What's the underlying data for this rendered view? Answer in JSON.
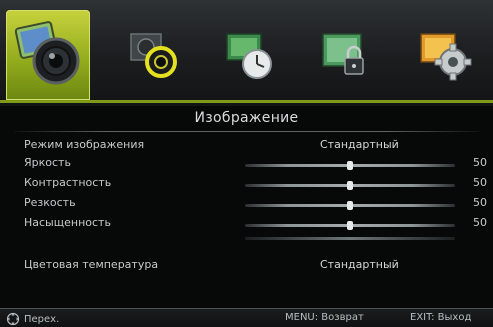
{
  "tabs": [
    {
      "name": "picture",
      "icon": "camera-lens-icon",
      "active": true
    },
    {
      "name": "sound",
      "icon": "speaker-icon",
      "active": false
    },
    {
      "name": "time",
      "icon": "clock-icon",
      "active": false
    },
    {
      "name": "lock",
      "icon": "lock-icon",
      "active": false
    },
    {
      "name": "setup",
      "icon": "gear-icon",
      "active": false
    }
  ],
  "menu": {
    "title": "Изображение",
    "picture_mode": {
      "label": "Режим изображения",
      "value": "Стандартный"
    },
    "sliders": [
      {
        "label": "Яркость",
        "value": "50",
        "level": 0.5
      },
      {
        "label": "Контрастность",
        "value": "50",
        "level": 0.5
      },
      {
        "label": "Резкость",
        "value": "50",
        "level": 0.5
      },
      {
        "label": "Насыщенность",
        "value": "50",
        "level": 0.5
      }
    ],
    "color_temp": {
      "label": "Цветовая температура",
      "value": "Стандартный"
    }
  },
  "footer": {
    "nav_label": "Перех.",
    "menu_hint": "MENU: Возврат",
    "exit_hint": "EXIT: Выход"
  },
  "colors": {
    "accent": "#8fa91b",
    "background": "#070808"
  }
}
